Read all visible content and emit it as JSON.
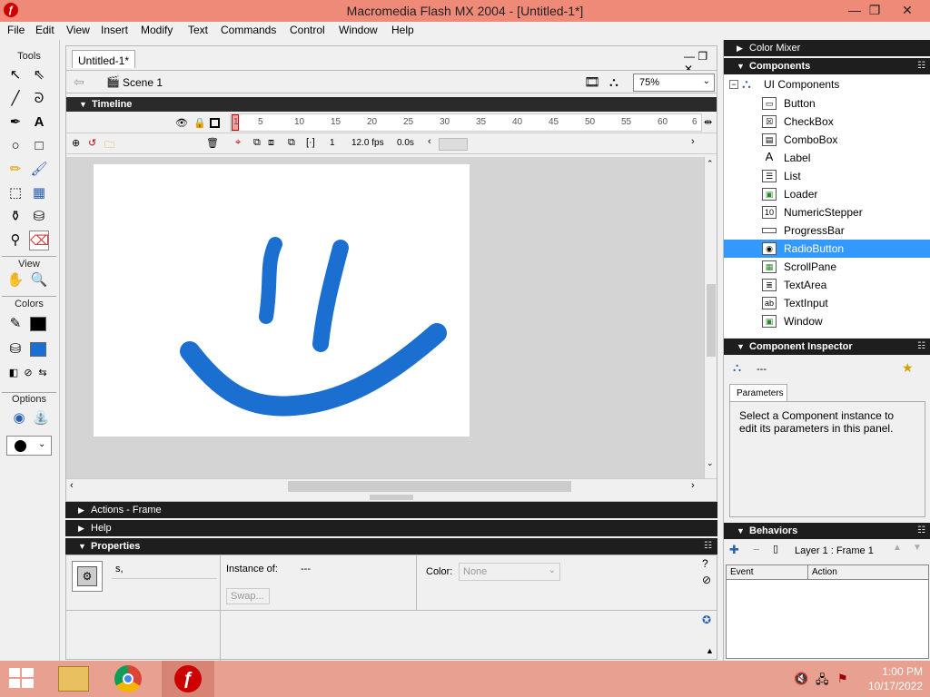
{
  "window": {
    "title": "Macromedia Flash MX 2004 - [Untitled-1*]",
    "minimize": "—",
    "restore": "❐",
    "close": "✕"
  },
  "menu": [
    "File",
    "Edit",
    "View",
    "Insert",
    "Modify",
    "Text",
    "Commands",
    "Control",
    "Window",
    "Help"
  ],
  "tools": {
    "tools_label": "Tools",
    "view_label": "View",
    "colors_label": "Colors",
    "options_label": "Options"
  },
  "document": {
    "tab": "Untitled-1*",
    "scene": "Scene 1",
    "zoom": "75%",
    "timeline_label": "Timeline",
    "frame_numbers": [
      "1",
      "5",
      "10",
      "15",
      "20",
      "25",
      "30",
      "35",
      "40",
      "45",
      "50",
      "55",
      "60",
      "6"
    ],
    "current_frame": "1",
    "fps": "12.0 fps",
    "time": "0.0s"
  },
  "panels": {
    "actions": "Actions - Frame",
    "help": "Help",
    "properties": "Properties",
    "instance_of_label": "Instance of:",
    "instance_of_value": "---",
    "swap_button": "Swap...",
    "color_label": "Color:",
    "color_value": "None",
    "name_field": "s,"
  },
  "right": {
    "color_mixer": "Color Mixer",
    "components": "Components",
    "ui_components": "UI Components",
    "items": [
      {
        "label": "Button",
        "icon": "▭"
      },
      {
        "label": "CheckBox",
        "icon": "☒"
      },
      {
        "label": "ComboBox",
        "icon": "▤"
      },
      {
        "label": "Label",
        "icon": "A"
      },
      {
        "label": "List",
        "icon": "☰"
      },
      {
        "label": "Loader",
        "icon": "▣"
      },
      {
        "label": "NumericStepper",
        "icon": "10"
      },
      {
        "label": "ProgressBar",
        "icon": "▬"
      },
      {
        "label": "RadioButton",
        "icon": "◉"
      },
      {
        "label": "ScrollPane",
        "icon": "▦"
      },
      {
        "label": "TextArea",
        "icon": "≣"
      },
      {
        "label": "TextInput",
        "icon": "ab"
      },
      {
        "label": "Window",
        "icon": "▣"
      }
    ],
    "selected_index": 8,
    "inspector": "Component Inspector",
    "inspector_value": "---",
    "parameters_tab": "Parameters",
    "inspector_message": "Select a Component instance to edit its parameters in this panel.",
    "behaviors": "Behaviors",
    "behaviors_layer": "Layer 1 : Frame 1",
    "event_col": "Event",
    "action_col": "Action"
  },
  "taskbar": {
    "time": "1:00 PM",
    "date": "10/17/2022"
  },
  "colors": {
    "stroke": "#000000",
    "fill": "#1a6fd1",
    "accent": "#3399ff",
    "titlebar": "#f08a78"
  }
}
